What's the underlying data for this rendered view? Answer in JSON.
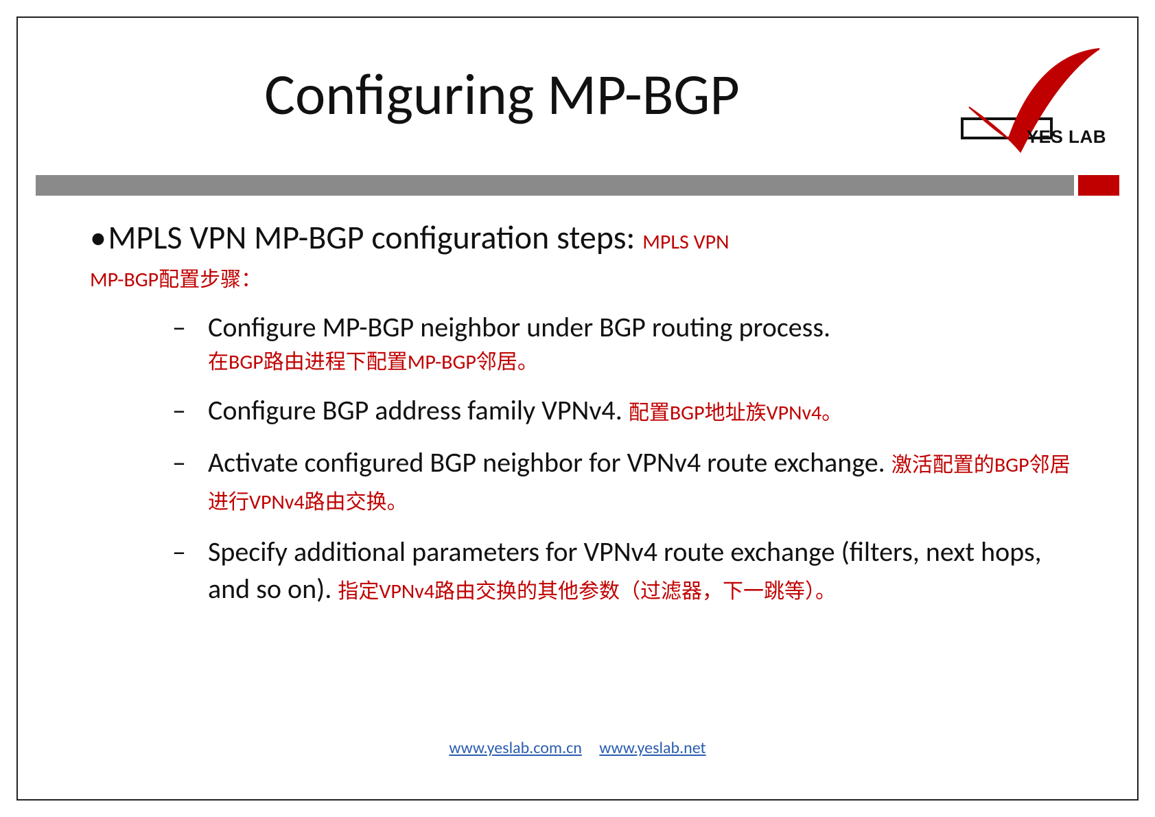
{
  "title": "Configuring MP-BGP",
  "logo": {
    "text": "YES LAB"
  },
  "lead": {
    "en": "MPLS VPN MP-BGP configuration steps:",
    "zh_inline": "MPLS VPN",
    "zh_block": "MP-BGP配置步骤："
  },
  "steps": [
    {
      "en": "Configure MP-BGP neighbor under BGP routing process.",
      "zh": "在BGP路由进程下配置MP-BGP邻居。",
      "zh_inline": false
    },
    {
      "en": "Configure BGP address family VPNv4.",
      "zh": "配置BGP地址族VPNv4。",
      "zh_inline": true
    },
    {
      "en": "Activate configured BGP neighbor for VPNv4 route exchange.",
      "zh": "激活配置的BGP邻居进行VPNv4路由交换。",
      "zh_inline": true
    },
    {
      "en": "Specify additional parameters for VPNv4 route exchange (filters, next hops, and so on).",
      "zh": "指定VPNv4路由交换的其他参数（过滤器，下一跳等）。",
      "zh_inline": true
    }
  ],
  "footer": {
    "link1": "www.yeslab.com.cn",
    "link2": "www.yeslab.net"
  }
}
